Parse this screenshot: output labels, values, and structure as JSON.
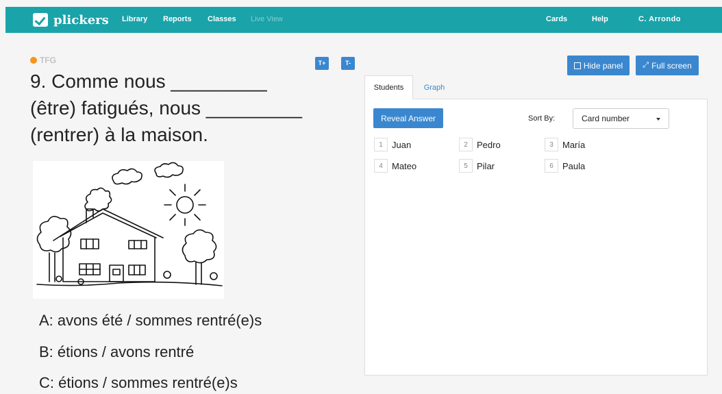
{
  "nav": {
    "brand": "plickers",
    "links": [
      "Library",
      "Reports",
      "Classes",
      "Live View"
    ],
    "right": [
      "Cards",
      "Help",
      "C. Arrondo"
    ]
  },
  "question": {
    "tag": "TFG",
    "text": "9. Comme nous _________ (être) fatigués, nous _________ (rentrer) à la maison.",
    "font_up": "T+",
    "font_down": "T-",
    "answers": [
      "A: avons été / sommes rentré(e)s",
      "B: étions / avons rentré",
      "C: étions / sommes rentré(e)s"
    ]
  },
  "panel": {
    "hide_label": "Hide panel",
    "fullscreen_label": "Full screen",
    "tabs": [
      "Students",
      "Graph"
    ],
    "reveal_label": "Reveal Answer",
    "sort_label": "Sort By:",
    "sort_value": "Card number",
    "students": [
      {
        "num": "1",
        "name": "Juan"
      },
      {
        "num": "2",
        "name": "Pedro"
      },
      {
        "num": "3",
        "name": "María"
      },
      {
        "num": "4",
        "name": "Mateo"
      },
      {
        "num": "5",
        "name": "Pilar"
      },
      {
        "num": "6",
        "name": "Paula"
      }
    ]
  },
  "colors": {
    "teal": "#1aa3a9",
    "blue": "#3a87cf",
    "tag_dot": "#f7941d"
  }
}
